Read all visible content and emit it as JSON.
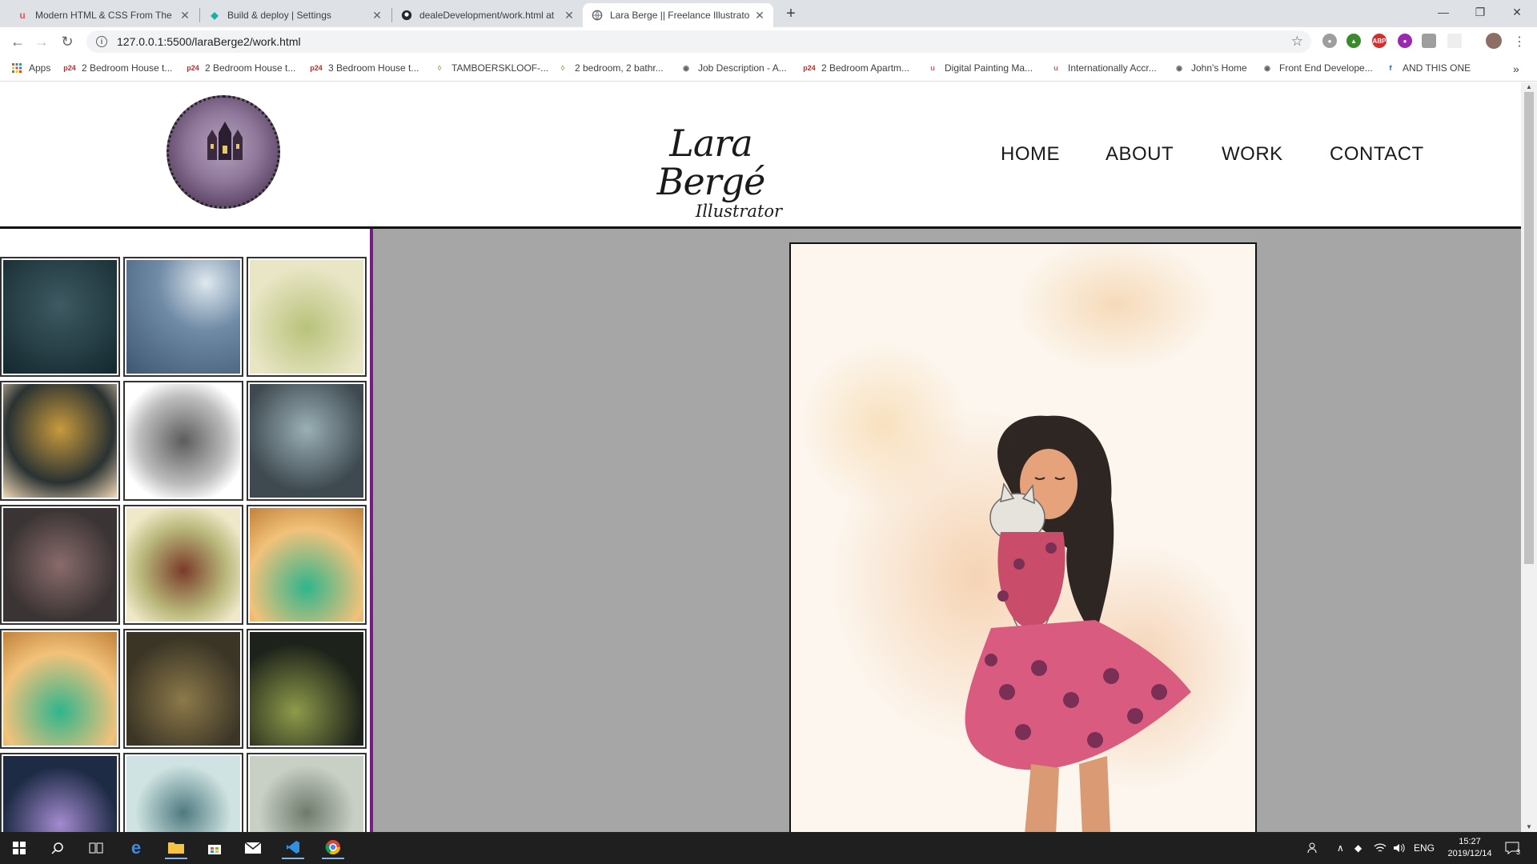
{
  "browser": {
    "tabs": [
      {
        "title": "Modern HTML & CSS From The B",
        "icon": "udemy-icon"
      },
      {
        "title": "Build & deploy | Settings",
        "icon": "netlify-icon"
      },
      {
        "title": "dealeDevelopment/work.html at",
        "icon": "github-icon"
      },
      {
        "title": "Lara Berge || Freelance Illustrator",
        "icon": "globe-icon"
      }
    ],
    "url": "127.0.0.1:5500/laraBerge2/work.html",
    "bookmarks": [
      "Apps",
      "2 Bedroom House t...",
      "2 Bedroom House t...",
      "3 Bedroom House t...",
      "TAMBOERSKLOOF-...",
      "2 bedroom, 2 bathr...",
      "Job Description - A...",
      "2 Bedroom Apartm...",
      "Digital Painting Ma...",
      "Internationally Accr...",
      "John's Home",
      "Front End Develope...",
      "AND THIS ONE"
    ],
    "bookmark_more": "»"
  },
  "site": {
    "brand_name": "Lara Bergé",
    "brand_sub": "Illustrator",
    "nav": [
      "HOME",
      "ABOUT",
      "WORK",
      "CONTACT"
    ]
  },
  "taskbar": {
    "language": "ENG",
    "time": "15:27",
    "date": "2019/12/14",
    "notifications": "3"
  },
  "colors": {
    "accent_border": "#7a1a8a",
    "viewer_bg": "#a6a6a6"
  }
}
